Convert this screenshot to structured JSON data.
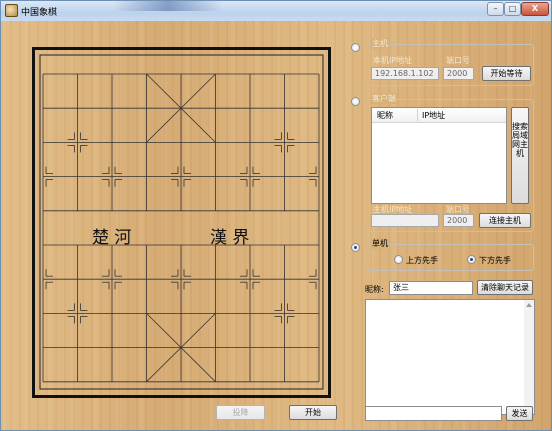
{
  "window": {
    "title": "中国象棋",
    "minimize": "–",
    "maximize": "□",
    "close": "X"
  },
  "board": {
    "river_left": "楚 河",
    "river_right": "漢 界"
  },
  "host_group": {
    "caption": "主机",
    "ip_label": "本机IP地址",
    "port_label": "端口号",
    "ip_value": "192.168.1.102",
    "port_value": "2000",
    "start_wait_button": "开始等待"
  },
  "client_group": {
    "caption": "客户端",
    "columns": [
      "昵称",
      "IP地址"
    ],
    "rows": [],
    "search_button": "搜索局域网主机",
    "host_ip_label": "主机IP地址",
    "port_label": "端口号",
    "host_ip_value": "",
    "port_value": "2000",
    "connect_button": "连接主机"
  },
  "single_group": {
    "caption": "单机",
    "option_top": "上方先手",
    "option_bottom": "下方先手",
    "selected": "下方先手"
  },
  "mode_selected": "单机",
  "chat": {
    "nickname_label": "昵称:",
    "nickname_value": "张三",
    "clear_button": "清除聊天记录",
    "message_value": "",
    "send_button": "发送"
  },
  "footer": {
    "surrender_button": "投降",
    "start_button": "开始"
  }
}
